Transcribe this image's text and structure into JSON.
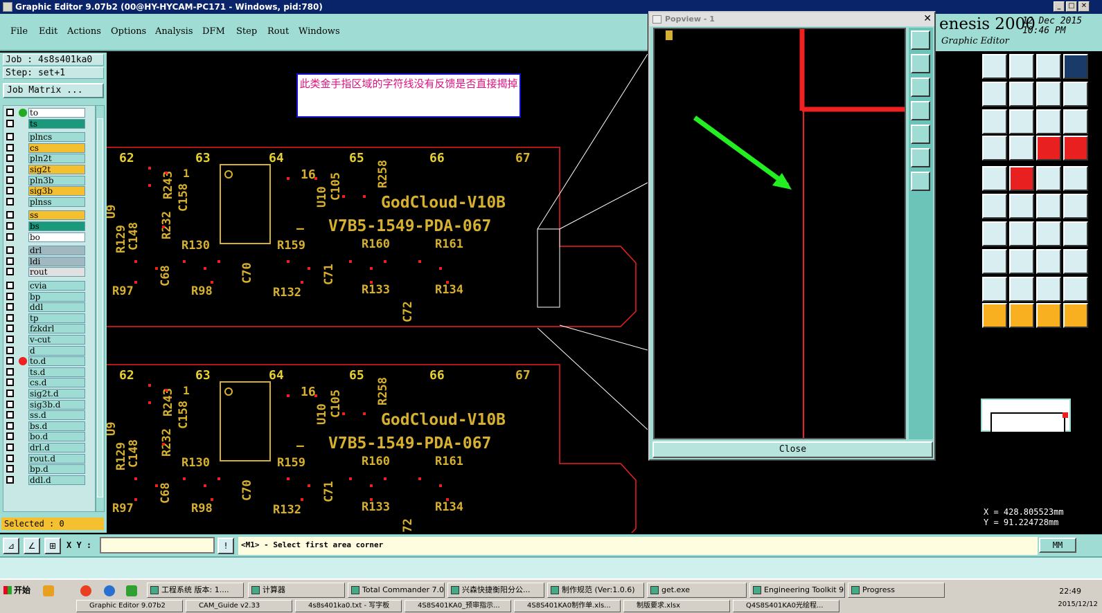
{
  "window": {
    "title": "Graphic Editor 9.07b2 (00@HY-HYCAM-PC171 - Windows, pid:780)"
  },
  "menu": [
    "File",
    "Edit",
    "Actions",
    "Options",
    "Analysis",
    "DFM",
    "Step",
    "Rout",
    "Windows"
  ],
  "brand": {
    "title": "enesis 2000",
    "subtitle": "Graphic Editor",
    "date_line1": "12 Dec 2015",
    "date_line2": "10:46 PM"
  },
  "job": {
    "job_label": "Job : 4s8s401ka0",
    "step_label": "Step: set+1",
    "matrix_button": "Job Matrix ..."
  },
  "layers": [
    {
      "name": "to",
      "color": "#ffffff",
      "dot": "#22aa22"
    },
    {
      "name": "ts",
      "color": "#1a9a7a",
      "dot": ""
    },
    {
      "name": "plncs",
      "color": "#9fdcd4",
      "dot": ""
    },
    {
      "name": "cs",
      "color": "#f5c030",
      "dot": ""
    },
    {
      "name": "pln2t",
      "color": "#9fdcd4",
      "dot": ""
    },
    {
      "name": "sig2t",
      "color": "#f5c030",
      "dot": ""
    },
    {
      "name": "pln3b",
      "color": "#9fdcd4",
      "dot": ""
    },
    {
      "name": "sig3b",
      "color": "#f5c030",
      "dot": ""
    },
    {
      "name": "plnss",
      "color": "#9fdcd4",
      "dot": ""
    },
    {
      "name": "ss",
      "color": "#f5c030",
      "dot": ""
    },
    {
      "name": "bs",
      "color": "#1a9a7a",
      "dot": ""
    },
    {
      "name": "bo",
      "color": "#ffffff",
      "dot": ""
    },
    {
      "name": "drl",
      "color": "#a0b8c0",
      "dot": ""
    },
    {
      "name": "ldi",
      "color": "#a0b8c0",
      "dot": ""
    },
    {
      "name": "rout",
      "color": "#e0e0e0",
      "dot": ""
    },
    {
      "name": "cvia",
      "color": "#9fdcd4",
      "dot": ""
    },
    {
      "name": "bp",
      "color": "#9fdcd4",
      "dot": ""
    },
    {
      "name": "ddl",
      "color": "#9fdcd4",
      "dot": ""
    },
    {
      "name": "tp",
      "color": "#9fdcd4",
      "dot": ""
    },
    {
      "name": "fzkdrl",
      "color": "#9fdcd4",
      "dot": ""
    },
    {
      "name": "v-cut",
      "color": "#9fdcd4",
      "dot": ""
    },
    {
      "name": "d",
      "color": "#9fdcd4",
      "dot": ""
    },
    {
      "name": "to.d",
      "color": "#9fdcd4",
      "dot": "#ee2020"
    },
    {
      "name": "ts.d",
      "color": "#9fdcd4",
      "dot": ""
    },
    {
      "name": "cs.d",
      "color": "#9fdcd4",
      "dot": ""
    },
    {
      "name": "sig2t.d",
      "color": "#9fdcd4",
      "dot": ""
    },
    {
      "name": "sig3b.d",
      "color": "#9fdcd4",
      "dot": ""
    },
    {
      "name": "ss.d",
      "color": "#9fdcd4",
      "dot": ""
    },
    {
      "name": "bs.d",
      "color": "#9fdcd4",
      "dot": ""
    },
    {
      "name": "bo.d",
      "color": "#9fdcd4",
      "dot": ""
    },
    {
      "name": "drl.d",
      "color": "#9fdcd4",
      "dot": ""
    },
    {
      "name": "rout.d",
      "color": "#9fdcd4",
      "dot": ""
    },
    {
      "name": "bp.d",
      "color": "#9fdcd4",
      "dot": ""
    },
    {
      "name": "ddl.d",
      "color": "#9fdcd4",
      "dot": ""
    }
  ],
  "selected": "Selected : 0",
  "note": "此类金手指区域的字符线没有反馈是否直接揭掉",
  "pcb": {
    "nums": [
      "62",
      "63",
      "64",
      "65",
      "66",
      "67"
    ],
    "refs": [
      "R243",
      "C158",
      "R129",
      "C148",
      "R232",
      "R130",
      "R159",
      "R160",
      "R161",
      "C68",
      "C70",
      "C71",
      "R97",
      "R98",
      "R132",
      "R133",
      "R134",
      "C72",
      "U10",
      "C105",
      "R258",
      "U9"
    ],
    "line1": "GodCloud-V10B",
    "line2": "V7B5-1549-PDA-067",
    "misc": [
      "16",
      "1",
      "—"
    ]
  },
  "popview": {
    "title": "Popview - 1",
    "close": "Close"
  },
  "coords": {
    "x": "X = 428.805523mm",
    "y": "Y =  91.224728mm"
  },
  "cmd": {
    "xy_label": "X Y :",
    "prompt": "<M1> - Select first area corner",
    "units": "MM",
    "help": "!"
  },
  "taskbar": {
    "start": "开始",
    "tasks": [
      "工程系统  版本: 1....",
      "计算器",
      "Total Commander 7.0...",
      "兴森快捷衡阳分公...",
      "制作规范 (Ver:1.0.6)",
      "get.exe",
      "Engineering Toolkit 9....",
      "Progress"
    ],
    "tasks2": [
      "Graphic Editor 9.07b2",
      "CAM_Guide v2.33",
      "4s8s401ka0.txt - 写字板",
      "4S8S401KA0_预审指示...",
      "4S8S401KA0制作单.xls...",
      "制版要求.xlsx",
      "Q4S8S401KA0光绘程..."
    ],
    "time": "22:49",
    "date": "2015/12/12"
  },
  "colors": {
    "accent": "#9fdcd4",
    "board_outline": "#ee2020",
    "silk": "#d8b030",
    "pad": "#ee2020"
  }
}
